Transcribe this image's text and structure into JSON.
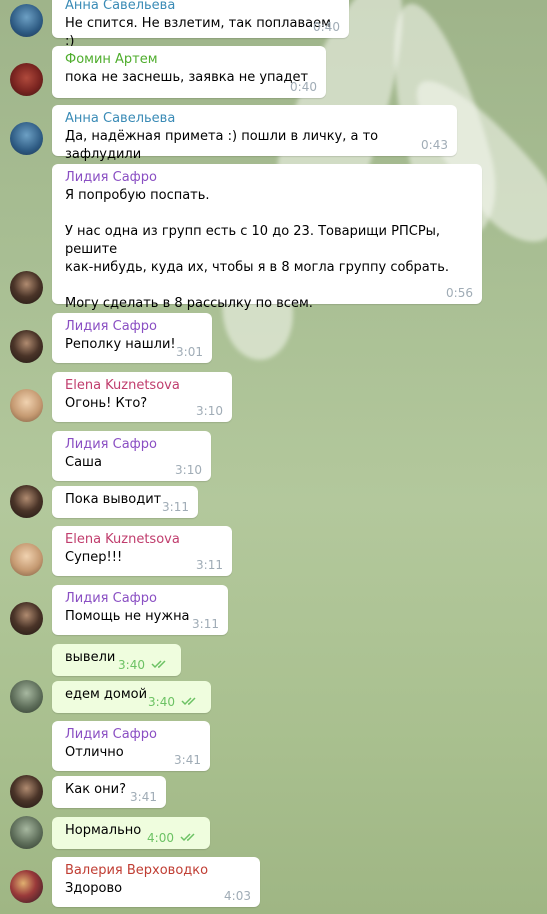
{
  "colors": {
    "sender_anna": "#3a8bb6",
    "sender_fomin": "#4fad2d",
    "sender_lidiya": "#8a4fc3",
    "sender_elena": "#c03d6d",
    "sender_valeria": "#c03d33",
    "read_check": "#6cc264"
  },
  "messages": [
    {
      "sender": "Анна Савельева",
      "text": "Не спится. Не взлетим, так поплаваем :)",
      "time": "0:40",
      "avatar_icon": "anna-avatar-icon"
    },
    {
      "sender": "Фомин Артем",
      "text": "пока не заснешь, заявка не упадет",
      "time": "0:40",
      "avatar_icon": "fomin-avatar-icon"
    },
    {
      "sender": "Анна Савельева",
      "text": "Да, надёжная примета :) пошли в личку, а то зафлудили",
      "time": "0:43",
      "avatar_icon": "anna-avatar-icon"
    },
    {
      "sender": "Лидия Сафро",
      "text": "Я попробую поспать.\n\nУ нас одна из групп есть с 10 до 23. Товарищи РПСРы, решите\nкак-нибудь, куда их, чтобы я в 8 могла группу собрать.\n\nМогу сделать в 8 рассылку по всем.",
      "time": "0:56",
      "avatar_icon": "lidiya-avatar-icon"
    },
    {
      "sender": "Лидия Сафро",
      "text": "Реполку нашли!",
      "time": "3:01",
      "avatar_icon": "lidiya-avatar-icon"
    },
    {
      "sender": "Elena Kuznetsova",
      "text": "Огонь! Кто?",
      "time": "3:10",
      "avatar_icon": "elena-avatar-icon"
    },
    {
      "sender": "Лидия Сафро",
      "text": "Саша",
      "time": "3:10",
      "avatar_icon": ""
    },
    {
      "sender": "",
      "text": "Пока выводит",
      "time": "3:11",
      "avatar_icon": "lidiya-avatar-icon"
    },
    {
      "sender": "Elena Kuznetsova",
      "text": "Супер!!!",
      "time": "3:11",
      "avatar_icon": "elena-avatar-icon"
    },
    {
      "sender": "Лидия Сафро",
      "text": "Помощь не нужна",
      "time": "3:11",
      "avatar_icon": "lidiya-avatar-icon"
    },
    {
      "sender": "",
      "text": "вывели",
      "time": "3:40",
      "avatar_icon": "",
      "outgoing": true
    },
    {
      "sender": "",
      "text": "едем домой",
      "time": "3:40",
      "avatar_icon": "self-avatar-icon",
      "outgoing": true
    },
    {
      "sender": "Лидия Сафро",
      "text": "Отлично",
      "time": "3:41",
      "avatar_icon": ""
    },
    {
      "sender": "",
      "text": "Как они?",
      "time": "3:41",
      "avatar_icon": "lidiya-avatar-icon"
    },
    {
      "sender": "",
      "text": "Нормально",
      "time": "4:00",
      "avatar_icon": "self-avatar-icon",
      "outgoing": true
    },
    {
      "sender": "Валерия Верховодко",
      "text": "Здорово",
      "time": "4:03",
      "avatar_icon": "valeria-avatar-icon"
    }
  ]
}
